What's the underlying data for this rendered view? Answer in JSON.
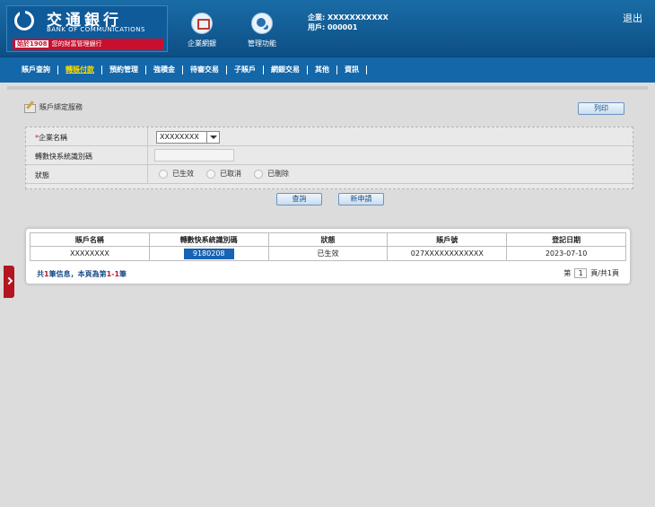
{
  "header": {
    "logo_cn": "交通銀行",
    "logo_en": "BANK OF COMMUNICATIONS",
    "logo_since": "始於1908",
    "logo_slogan": "您的財富管理銀行",
    "icons": [
      {
        "label": "企業網銀",
        "icon": "monitor-icon"
      },
      {
        "label": "管理功能",
        "icon": "gears-icon"
      }
    ],
    "company_line": "企業: XXXXXXXXXXX",
    "user_line": "用戶: 000001",
    "logout_label": "退出"
  },
  "nav": {
    "items": [
      "賬戶查詢",
      "轉賬付款",
      "預約管理",
      "強積金",
      "待審交易",
      "子賬戶",
      "網銀交易",
      "其他",
      "資訊"
    ],
    "active_index": 1
  },
  "page": {
    "title": "賬戶綁定服務",
    "print_label": "列印"
  },
  "form": {
    "company_label": "企業名稱",
    "company_value": "XXXXXXXX",
    "fps_label": "轉數快系統識別碼",
    "fps_value": "",
    "status_label": "狀態",
    "status_options": [
      "已生效",
      "已取消",
      "已刪除"
    ],
    "query_label": "查詢",
    "new_label": "新申請"
  },
  "table": {
    "headers": [
      "賬戶名稱",
      "轉數快系統識別碼",
      "狀態",
      "賬戶號",
      "登記日期"
    ],
    "rows": [
      [
        "XXXXXXXX",
        "9180208",
        "已生效",
        "027XXXXXXXXXXXX",
        "2023-07-10"
      ]
    ],
    "summary_prefix": "共",
    "summary_count": "1",
    "summary_mid": "筆信息，本頁為第",
    "summary_range": "1-1",
    "summary_suffix": "筆",
    "page_prefix": "第",
    "page_current": "1",
    "page_suffix": "頁/共1頁"
  },
  "colors": {
    "header_blue": "#0d4f86",
    "nav_blue": "#1467a8",
    "active_nav": "#ffdd00",
    "brand_red": "#c8102e"
  }
}
